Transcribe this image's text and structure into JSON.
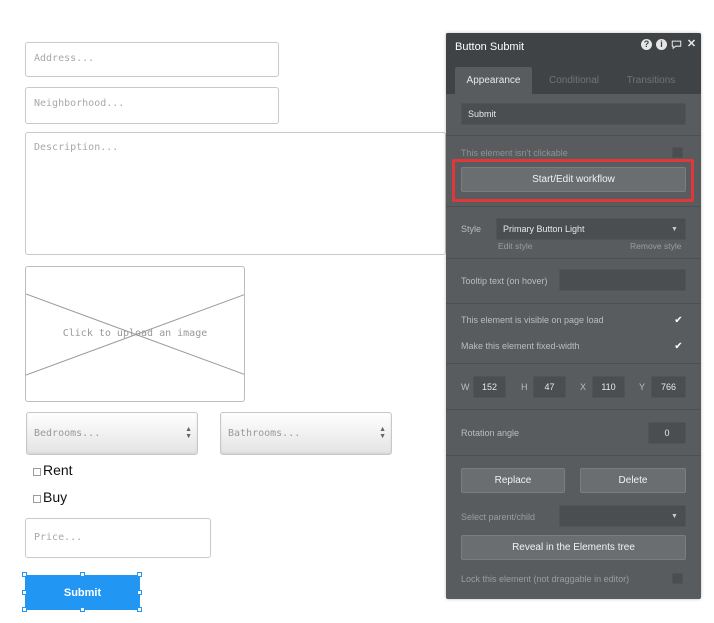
{
  "canvas": {
    "address_placeholder": "Address...",
    "neighborhood_placeholder": "Neighborhood...",
    "description_placeholder": "Description...",
    "image_caption": "Click to upload an image",
    "bedrooms_placeholder": "Bedrooms...",
    "bathrooms_placeholder": "Bathrooms...",
    "rent_label": "Rent",
    "buy_label": "Buy",
    "price_placeholder": "Price...",
    "submit_label": "Submit",
    "submit_color": "#2196f3"
  },
  "panel": {
    "title": "Button Submit",
    "icons": [
      "help-icon",
      "info-icon",
      "comment-icon",
      "close-icon"
    ],
    "tabs": [
      {
        "label": "Appearance",
        "active": true
      },
      {
        "label": "Conditional",
        "active": false
      },
      {
        "label": "Transitions",
        "active": false
      }
    ],
    "text_value": "Submit",
    "not_clickable_label": "This element isn't clickable",
    "not_clickable_checked": false,
    "workflow_button": "Start/Edit workflow",
    "style_label": "Style",
    "style_value": "Primary Button Light",
    "edit_style": "Edit style",
    "remove_style": "Remove style",
    "tooltip_label": "Tooltip text (on hover)",
    "tooltip_value": "",
    "visible_label": "This element is visible on page load",
    "visible_checked": true,
    "fixed_width_label": "Make this element fixed-width",
    "fixed_width_checked": true,
    "w_label": "W",
    "w_value": "152",
    "h_label": "H",
    "h_value": "47",
    "x_label": "X",
    "x_value": "110",
    "y_label": "Y",
    "y_value": "766",
    "rotation_label": "Rotation angle",
    "rotation_value": "0",
    "replace_button": "Replace",
    "delete_button": "Delete",
    "parent_label": "Select parent/child",
    "reveal_button": "Reveal in the Elements tree",
    "lock_label": "Lock this element (not draggable in editor)",
    "lock_checked": false,
    "highlight_color": "#e0383a"
  }
}
